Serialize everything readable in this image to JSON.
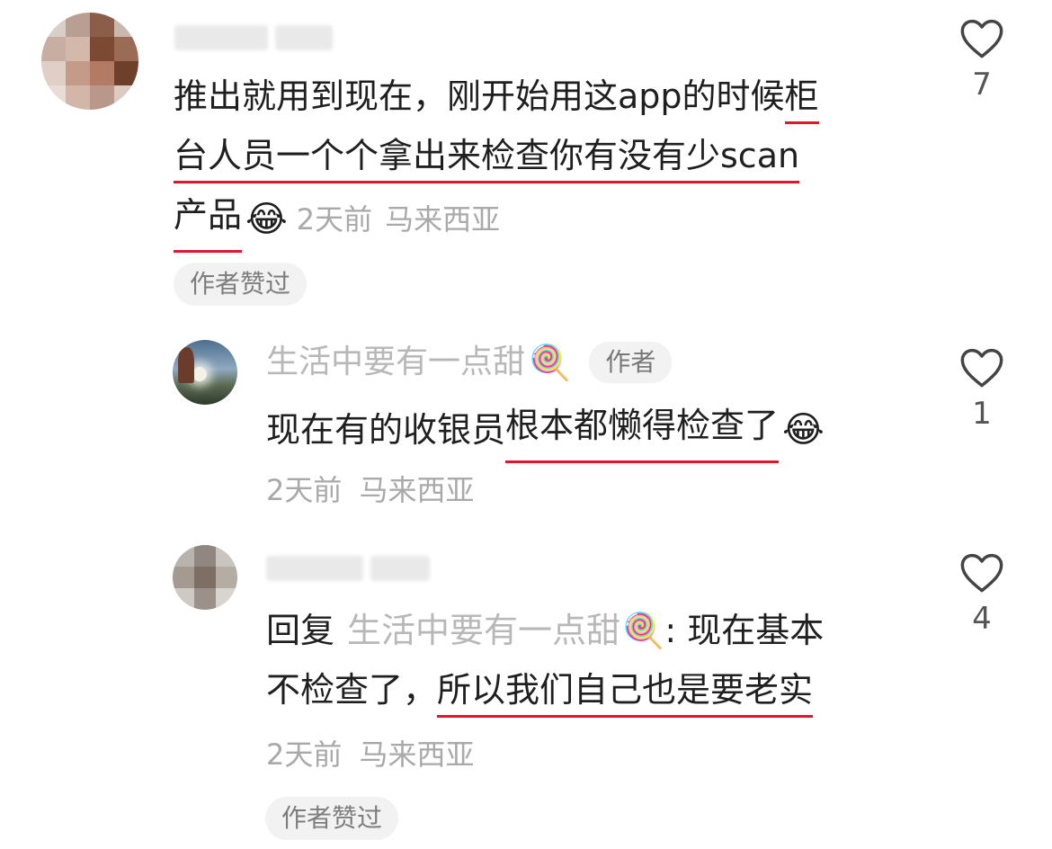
{
  "comments": [
    {
      "text_parts": [
        "推出就用到现在，刚开始用这app的时候",
        "柜",
        "台人员一个个拿出来检查你有没有少scan",
        "产品"
      ],
      "emoji": "😂",
      "time": "2天前",
      "location": "马来西亚",
      "author_liked": "作者赞过",
      "likes": "7"
    },
    {
      "username": "生活中要有一点甜",
      "username_emoji": "🍭",
      "author_tag": "作者",
      "text_plain": "现在有的收银员",
      "text_underlined": "根本都懒得检查了",
      "emoji": "😂",
      "time": "2天前",
      "location": "马来西亚",
      "likes": "1"
    },
    {
      "reply_prefix": "回复",
      "reply_to": "生活中要有一点甜",
      "reply_to_emoji": "🍭",
      "text_line1": ": 现在基本",
      "text_line2_plain": "不检查了，",
      "text_line2_underlined": "所以我们自己也是要老实",
      "time": "2天前",
      "location": "马来西亚",
      "author_liked": "作者赞过",
      "likes": "4"
    }
  ]
}
